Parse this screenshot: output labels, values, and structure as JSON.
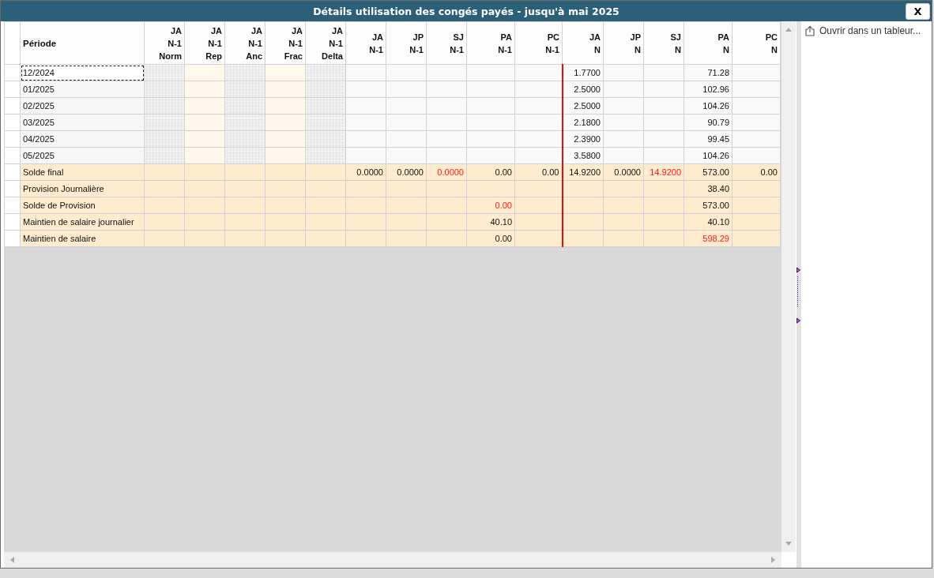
{
  "window": {
    "title": "Détails utilisation des congés payés - jusqu'à mai 2025",
    "close": "X"
  },
  "table": {
    "period_heading": "Période",
    "columns": [
      {
        "lines": [
          "JA",
          "N-1",
          "Norm"
        ],
        "kind": "hatched"
      },
      {
        "lines": [
          "JA",
          "N-1",
          "Rep"
        ],
        "kind": "input"
      },
      {
        "lines": [
          "JA",
          "N-1",
          "Anc"
        ],
        "kind": "hatched"
      },
      {
        "lines": [
          "JA",
          "N-1",
          "Frac"
        ],
        "kind": "input"
      },
      {
        "lines": [
          "JA",
          "N-1",
          "Delta"
        ],
        "kind": "hatched"
      },
      {
        "lines": [
          "JA",
          "N-1"
        ],
        "kind": "plain"
      },
      {
        "lines": [
          "JP",
          "N-1"
        ],
        "kind": "plain"
      },
      {
        "lines": [
          "SJ",
          "N-1"
        ],
        "kind": "plain"
      },
      {
        "lines": [
          "PA",
          "N-1"
        ],
        "kind": "plain"
      },
      {
        "lines": [
          "PC",
          "N-1"
        ],
        "kind": "plain"
      },
      {
        "lines": [
          "JA",
          "N"
        ],
        "kind": "year-start"
      },
      {
        "lines": [
          "JP",
          "N"
        ],
        "kind": "plain"
      },
      {
        "lines": [
          "SJ",
          "N"
        ],
        "kind": "plain"
      },
      {
        "lines": [
          "PA",
          "N"
        ],
        "kind": "plain"
      },
      {
        "lines": [
          "PC",
          "N"
        ],
        "kind": "plain"
      }
    ],
    "rows": [
      {
        "label": "12/2024",
        "kind": "period",
        "selected": true,
        "cells": [
          null,
          null,
          null,
          null,
          null,
          null,
          null,
          null,
          null,
          null,
          {
            "text": "1.7700",
            "alert": false
          },
          null,
          null,
          {
            "text": "71.28",
            "alert": false
          },
          null
        ]
      },
      {
        "label": "01/2025",
        "kind": "period",
        "selected": false,
        "cells": [
          null,
          null,
          null,
          null,
          null,
          null,
          null,
          null,
          null,
          null,
          {
            "text": "2.5000",
            "alert": false
          },
          null,
          null,
          {
            "text": "102.96",
            "alert": false
          },
          null
        ]
      },
      {
        "label": "02/2025",
        "kind": "period",
        "selected": false,
        "cells": [
          null,
          null,
          null,
          null,
          null,
          null,
          null,
          null,
          null,
          null,
          {
            "text": "2.5000",
            "alert": false
          },
          null,
          null,
          {
            "text": "104.26",
            "alert": false
          },
          null
        ]
      },
      {
        "label": "03/2025",
        "kind": "period",
        "selected": false,
        "cells": [
          null,
          null,
          null,
          null,
          null,
          null,
          null,
          null,
          null,
          null,
          {
            "text": "2.1800",
            "alert": false
          },
          null,
          null,
          {
            "text": "90.79",
            "alert": false
          },
          null
        ]
      },
      {
        "label": "04/2025",
        "kind": "period",
        "selected": false,
        "cells": [
          null,
          null,
          null,
          null,
          null,
          null,
          null,
          null,
          null,
          null,
          {
            "text": "2.3900",
            "alert": false
          },
          null,
          null,
          {
            "text": "99.45",
            "alert": false
          },
          null
        ]
      },
      {
        "label": "05/2025",
        "kind": "period",
        "selected": false,
        "cells": [
          null,
          null,
          null,
          null,
          null,
          null,
          null,
          null,
          null,
          null,
          {
            "text": "3.5800",
            "alert": false
          },
          null,
          null,
          {
            "text": "104.26",
            "alert": false
          },
          null
        ]
      },
      {
        "label": "Solde final",
        "kind": "total",
        "selected": false,
        "cells": [
          null,
          null,
          null,
          null,
          null,
          {
            "text": "0.0000",
            "alert": false
          },
          {
            "text": "0.0000",
            "alert": false
          },
          {
            "text": "0.0000",
            "alert": true
          },
          {
            "text": "0.00",
            "alert": false
          },
          {
            "text": "0.00",
            "alert": false
          },
          {
            "text": "14.9200",
            "alert": false
          },
          {
            "text": "0.0000",
            "alert": false
          },
          {
            "text": "14.9200",
            "alert": true
          },
          {
            "text": "573.00",
            "alert": false
          },
          {
            "text": "0.00",
            "alert": false
          }
        ]
      },
      {
        "label": "Provision Journalière",
        "kind": "total",
        "selected": false,
        "cells": [
          null,
          null,
          null,
          null,
          null,
          null,
          null,
          null,
          null,
          null,
          null,
          null,
          null,
          {
            "text": "38.40",
            "alert": false
          },
          null
        ]
      },
      {
        "label": "Solde de Provision",
        "kind": "total",
        "selected": false,
        "cells": [
          null,
          null,
          null,
          null,
          null,
          null,
          null,
          null,
          {
            "text": "0.00",
            "alert": true
          },
          null,
          null,
          null,
          null,
          {
            "text": "573.00",
            "alert": false
          },
          null
        ]
      },
      {
        "label": "Maintien de salaire journalier",
        "kind": "total",
        "selected": false,
        "cells": [
          null,
          null,
          null,
          null,
          null,
          null,
          null,
          null,
          {
            "text": "40.10",
            "alert": false
          },
          null,
          null,
          null,
          null,
          {
            "text": "40.10",
            "alert": false
          },
          null
        ]
      },
      {
        "label": "Maintien de salaire",
        "kind": "total",
        "selected": false,
        "cells": [
          null,
          null,
          null,
          null,
          null,
          null,
          null,
          null,
          {
            "text": "0.00",
            "alert": false
          },
          null,
          null,
          null,
          null,
          {
            "text": "598.29",
            "alert": true
          },
          null
        ]
      }
    ]
  },
  "side_panel": {
    "action": "Ouvrir dans un tableur..."
  }
}
